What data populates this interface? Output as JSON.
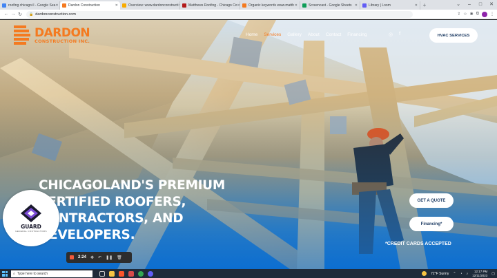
{
  "browser": {
    "tabs": [
      {
        "title": "roofing chicago il - Google Sea",
        "color": "#4285f4",
        "active": false
      },
      {
        "title": "Dardon Construction",
        "color": "#f47a20",
        "active": true
      },
      {
        "title": "Overview: www.dardonconstructi",
        "color": "#f9ab00",
        "active": false
      },
      {
        "title": "Matthews Roofing - Chicago Co",
        "color": "#b31b1b",
        "active": false
      },
      {
        "title": "Organic keywords www.matth",
        "color": "#f47a20",
        "active": false
      },
      {
        "title": "Screencast - Google Sheets",
        "color": "#0f9d58",
        "active": false
      },
      {
        "title": "Library | Loom",
        "color": "#625df5",
        "active": false
      }
    ],
    "url": "dardonconstruction.com"
  },
  "site": {
    "logo_name": "DARDON",
    "logo_sub": "CONSTRUCTION INC.",
    "nav": [
      "Home",
      "Services",
      "Gallery",
      "About",
      "Contact",
      "Financing"
    ],
    "nav_colors": {
      "active": "#f47a20"
    },
    "hvac_button": "HVAC SERVICES",
    "headline": "CHICAGOLAND'S PREMIUM CERTIFIED ROOFERS, CONTRACTORS, AND DEVELOPERS.",
    "quote_button": "GET A QUOTE",
    "financing_button": "Financing*",
    "cc_note": "*CREDIT CARDS ACCEPTED"
  },
  "badge": {
    "name": "GUARD",
    "sub": "GENERAL CONTRACTORS"
  },
  "recorder": {
    "time": "2:24"
  },
  "taskbar": {
    "search_placeholder": "Type here to search",
    "weather": "72°F Sunny",
    "time": "12:17 PM",
    "date": "12/11/2023"
  },
  "colors": {
    "brand_orange": "#f47a20",
    "button_text": "#1d3b63"
  }
}
